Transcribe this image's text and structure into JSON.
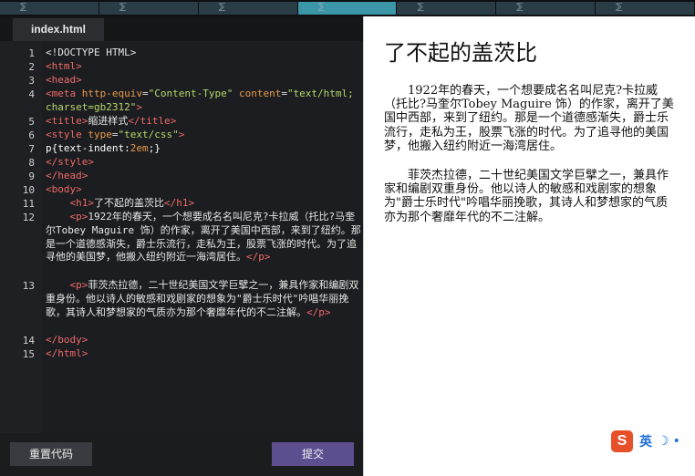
{
  "topbar": {
    "segments": 7,
    "active_index": 3,
    "mark": "⅀"
  },
  "editor": {
    "tab_label": "index.html",
    "line_numbers": [
      "1",
      "2",
      "3",
      "4",
      "5",
      "6",
      "7",
      "8",
      "9",
      "10",
      "11",
      "12",
      "13",
      "14",
      "15"
    ],
    "lines": [
      {
        "no": "1",
        "html": "&lt;!DOCTYPE HTML&gt;"
      },
      {
        "no": "2",
        "html": "<span class='t'>&lt;html&gt;</span>"
      },
      {
        "no": "3",
        "html": "<span class='t'>&lt;head&gt;</span>"
      },
      {
        "no": "4",
        "html": "<span class='t'>&lt;meta</span> <span class='a'>http-equiv</span>=<span class='s'>\"Content-Type\"</span> <span class='a'>content</span>=<span class='s'>\"text/html; charset=gb2312\"</span><span class='t'>&gt;</span>"
      },
      {
        "no": "5",
        "html": "<span class='t'>&lt;title&gt;</span>缩进样式<span class='t'>&lt;/title&gt;</span>"
      },
      {
        "no": "6",
        "html": "<span class='t'>&lt;style</span> <span class='a'>type</span>=<span class='s'>\"text/css\"</span><span class='t'>&gt;</span>"
      },
      {
        "no": "7",
        "html": "<span class='w'>p{text-indent:</span><span class='a'>2em</span><span class='w'>;}</span>"
      },
      {
        "no": "8",
        "html": "<span class='t'>&lt;/style&gt;</span>"
      },
      {
        "no": "9",
        "html": "<span class='t'>&lt;/head&gt;</span>"
      },
      {
        "no": "10",
        "html": "<span class='t'>&lt;body&gt;</span>"
      },
      {
        "no": "11",
        "html": "    <span class='t'>&lt;h1&gt;</span>了不起的盖茨比<span class='t'>&lt;/h1&gt;</span>"
      },
      {
        "no": "12",
        "html": "    <span class='t'>&lt;p&gt;</span>1922年的春天，一个想要成名名叫尼克?卡拉威（托比?马奎尔Tobey Maguire 饰）的作家，离开了美国中西部，来到了纽约。那是一个道德感渐失，爵士乐流行，走私为王，股票飞涨的时代。为了追寻他的美国梦，他搬入纽约附近一海湾居住。<span class='t'>&lt;/p&gt;</span>"
      },
      {
        "no": "13",
        "html": "    <span class='t'>&lt;p&gt;</span>菲茨杰拉德，二十世纪美国文学巨擘之一，兼具作家和编剧双重身份。他以诗人的敏感和戏剧家的想象为\"爵士乐时代\"吟唱华丽挽歌，其诗人和梦想家的气质亦为那个奢靡年代的不二注解。<span class='t'>&lt;/p&gt;</span>"
      },
      {
        "no": "14",
        "html": "<span class='t'>&lt;/body&gt;</span>"
      },
      {
        "no": "15",
        "html": "<span class='t'>&lt;/html&gt;</span>"
      }
    ],
    "reset_label": "重置代码",
    "submit_label": "提交"
  },
  "preview": {
    "title": "了不起的盖茨比",
    "paragraphs": [
      "1922年的春天，一个想要成名名叫尼克?卡拉威（托比?马奎尔Tobey Maguire 饰）的作家，离开了美国中西部，来到了纽约。那是一个道德感渐失，爵士乐流行，走私为王，股票飞涨的时代。为了追寻他的美国梦，他搬入纽约附近一海湾居住。",
      "菲茨杰拉德，二十世纪美国文学巨擘之一，兼具作家和编剧双重身份。他以诗人的敏感和戏剧家的想象为\"爵士乐时代\"吟唱华丽挽歌，其诗人和梦想家的气质亦为那个奢靡年代的不二注解。"
    ]
  },
  "ime": {
    "logo": "S",
    "lang": "英",
    "moon": "☽",
    "dot": "•"
  },
  "colors": {
    "tag": "#f06a6a",
    "attr": "#e89a4a",
    "string": "#b8d86a",
    "submit": "#5d4e90",
    "active_tab": "#3b96a8"
  }
}
